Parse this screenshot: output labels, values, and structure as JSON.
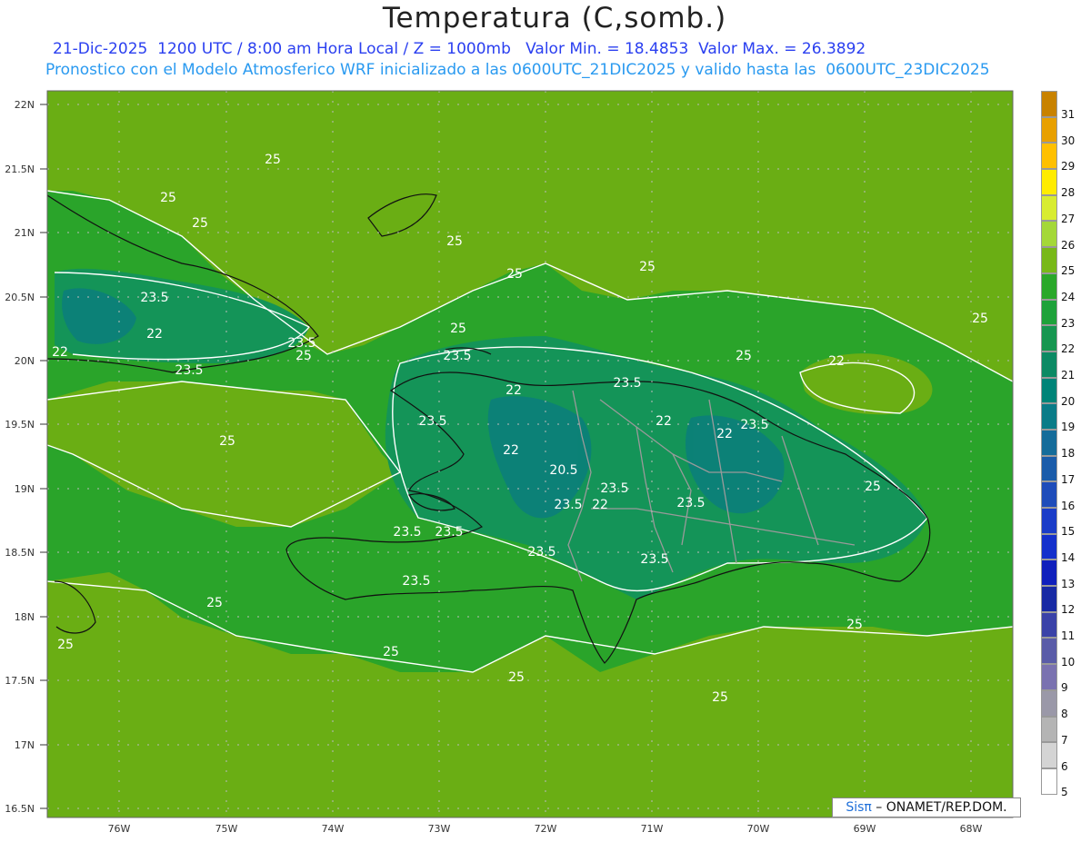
{
  "title": "Temperatura (C,somb.)",
  "subtitle_line1": "21-Dic-2025  1200 UTC / 8:00 am Hora Local / Z = 1000mb   Valor Min. = 18.4853  Valor Max. = 26.3892",
  "subtitle_line2": "Pronostico con el Modelo Atmosferico WRF inicializado a las 0600UTC_21DIC2025 y valido hasta las  0600UTC_23DIC2025",
  "credit": {
    "brand": "Sisπ",
    "text": " – ONAMET/REP.DOM."
  },
  "lat_labels": [
    "22N",
    "21.5N",
    "21N",
    "20.5N",
    "20N",
    "19.5N",
    "19N",
    "18.5N",
    "18N",
    "17.5N",
    "17N",
    "16.5N"
  ],
  "lon_labels": [
    "76W",
    "75W",
    "74W",
    "73W",
    "72W",
    "71W",
    "70W",
    "69W",
    "68W"
  ],
  "colorbar": {
    "labels": [
      "31",
      "30",
      "29",
      "28",
      "27",
      "26",
      "25",
      "24",
      "23",
      "22",
      "21",
      "20",
      "19",
      "18",
      "17",
      "16",
      "15",
      "14",
      "13",
      "12",
      "11",
      "10",
      "9",
      "8",
      "7",
      "6",
      "5"
    ],
    "colors": [
      "#c88200",
      "#e8a000",
      "#ffc000",
      "#ffec00",
      "#d8ec30",
      "#a4d838",
      "#78b818",
      "#2aa82a",
      "#1ea23a",
      "#169650",
      "#0c8a64",
      "#008478",
      "#0a7c88",
      "#156c9a",
      "#1a5caa",
      "#1e4cba",
      "#1a3cc8",
      "#1430cc",
      "#1020bc",
      "#182aa4",
      "#3a42a8",
      "#5a5ca8",
      "#7a72b0",
      "#9a98a8",
      "#b4b4b4",
      "#d4d4d4",
      "#ffffff"
    ]
  },
  "contour_labels": [
    "25",
    "25",
    "25",
    "25",
    "25",
    "25",
    "25",
    "23.5",
    "22",
    "22",
    "23.5",
    "23.5",
    "25",
    "25",
    "23.5",
    "25",
    "22",
    "23.5",
    "22",
    "23.5",
    "22",
    "22",
    "23.5",
    "20.5",
    "23.5",
    "22",
    "23.5",
    "22",
    "23.5",
    "23.5",
    "23.5",
    "23.5",
    "23.5",
    "25",
    "25",
    "25",
    "25",
    "25",
    "23.5",
    "25",
    "25",
    "25"
  ]
}
